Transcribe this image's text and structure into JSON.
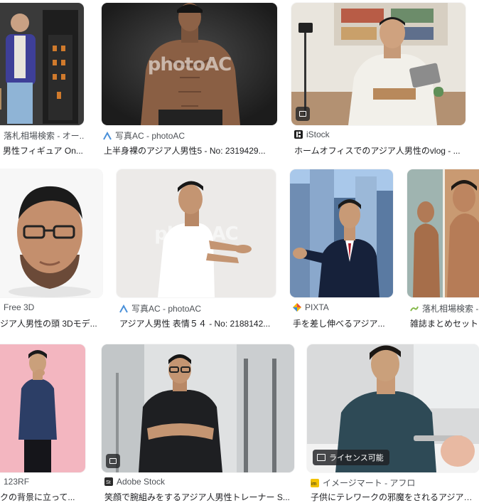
{
  "results": [
    {
      "source": "落札相場検索 - オー...",
      "caption": "男性フィギュア On...",
      "icon": "auction-icon",
      "badge": false
    },
    {
      "source": "写真AC - photoAC",
      "caption": "上半身裸のアジア人男性5 - No: 2319429...",
      "icon": "photoac-icon",
      "watermark": "photoAC",
      "badge": false
    },
    {
      "source": "iStock",
      "caption": "ホームオフィスでのアジア人男性のvlog - ...",
      "icon": "istock-icon",
      "badge": true
    },
    {
      "source": "Free 3D",
      "caption": "ジア人男性の頭 3Dモデ...",
      "icon": "free3d-icon",
      "badge": false
    },
    {
      "source": "写真AC - photoAC",
      "caption": "アジア人男性 表情５４ - No: 2188142...",
      "icon": "photoac-icon",
      "watermark": "photoAC",
      "badge": false
    },
    {
      "source": "PIXTA",
      "caption": "手を差し伸べるアジア...",
      "icon": "pixta-icon",
      "badge": false
    },
    {
      "source": "落札相場検索 -",
      "caption": "雑誌まとめセット...",
      "icon": "auction-icon",
      "badge": false
    },
    {
      "source": "123RF",
      "caption": "クの背景に立って...",
      "icon": "123rf-icon",
      "badge": false
    },
    {
      "source": "Adobe Stock",
      "caption": "笑顔で腕組みをするアジア人男性トレーナー S...",
      "icon": "adobe-stock-icon",
      "badge": true
    },
    {
      "source": "イメージマート - アフロ",
      "caption": "子供にテレワークの邪魔をされるアジア人男...",
      "icon": "imagemart-icon",
      "license": "ライセンス可能"
    }
  ],
  "colors": {
    "accent": "#1a73e8",
    "caption": "#202124",
    "source": "#4d5156"
  }
}
